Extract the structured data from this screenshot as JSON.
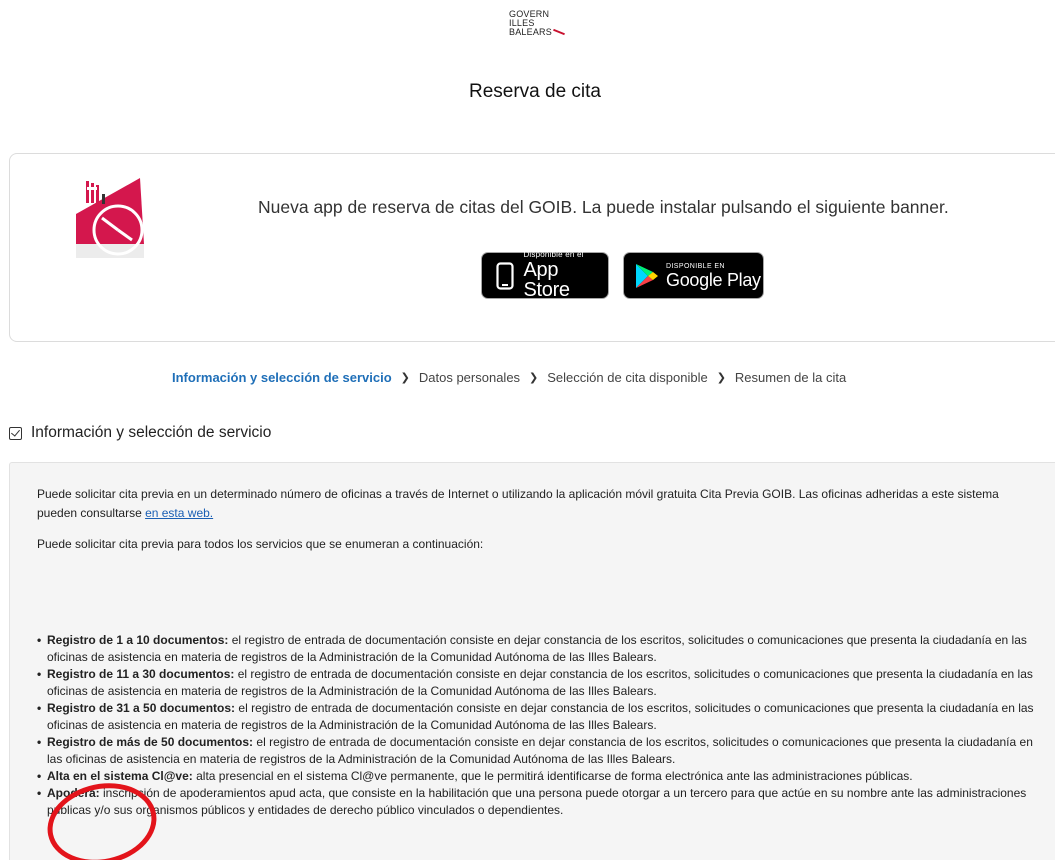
{
  "header": {
    "logo_line1": "GOVERN",
    "logo_line2": "ILLES",
    "logo_line3": "BALEARS",
    "page_title": "Reserva de cita"
  },
  "banner": {
    "text": "Nueva app de reserva de citas del GOIB. La puede instalar pulsando el siguiente banner.",
    "appstore_small": "Disponible en el",
    "appstore_big": "App Store",
    "gplay_small": "DISPONIBLE EN",
    "gplay_big": "Google Play"
  },
  "steps": [
    {
      "label": "Información y selección de servicio"
    },
    {
      "label": "Datos personales"
    },
    {
      "label": "Selección de cita disponible"
    },
    {
      "label": "Resumen de la cita"
    }
  ],
  "section": {
    "title": "Información y selección de servicio"
  },
  "info": {
    "p1_text": "Puede solicitar cita previa en un determinado número de oficinas a través de Internet o utilizando la aplicación móvil gratuita Cita Previa GOIB. Las oficinas adheridas a este sistema pueden consultarse ",
    "p1_link": "en esta web.",
    "p2_text": "Puede solicitar cita previa para todos los servicios que se enumeran a continuación:"
  },
  "services": [
    {
      "title": "Registro de 1 a 10 documentos:",
      "desc": " el registro de entrada de documentación consiste en dejar constancia de los escritos, solicitudes o comunicaciones que presenta la ciudadanía en  las oficinas de asistencia en materia de registros de la Administración de la Comunidad Autónoma de las Illes Balears."
    },
    {
      "title": "Registro de 11 a 30 documentos:",
      "desc": " el registro de entrada de documentación consiste en dejar constancia de los escritos, solicitudes o comunicaciones que presenta la ciudadanía en  las oficinas de asistencia en materia de registros de la Administración de la Comunidad Autónoma de las Illes Balears."
    },
    {
      "title": "Registro de 31 a 50 documentos:",
      "desc": " el registro de entrada de documentación consiste en dejar constancia de los escritos, solicitudes o comunicaciones que presenta la ciudadanía en  las oficinas de asistencia en materia de registros de la Administración de la Comunidad Autónoma de las Illes Balears."
    },
    {
      "title": "Registro de más de 50 documentos:",
      "desc": " el registro de entrada de documentación consiste en dejar constancia de los escritos, solicitudes o comunicaciones que presenta la ciudadanía en  las oficinas de asistencia en materia de registros de la Administración de la Comunidad Autónoma de las Illes Balears."
    },
    {
      "title": "Alta en el sistema Cl@ve:",
      "desc": " alta presencial en el sistema Cl@ve permanente, que le permitirá identificarse de forma electrónica ante las administraciones públicas."
    },
    {
      "title": "Apodera:",
      "desc": " inscripción de apoderamientos apud acta, que consiste en la habilitación que una persona puede otorgar a un tercero para que actúe en su nombre ante las administraciones públicas y/o sus organismos públicos y entidades de derecho público vinculados o dependientes."
    }
  ],
  "colors": {
    "accent": "#1f6fb8",
    "annotation": "#e3141b",
    "brand_red": "#c8102e"
  }
}
